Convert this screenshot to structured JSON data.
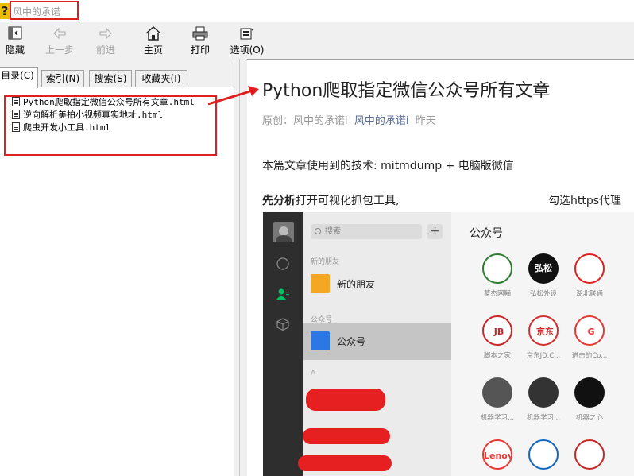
{
  "window": {
    "title": "风中的承诺"
  },
  "toolbar": {
    "hide": "隐藏",
    "back": "上一步",
    "forward": "前进",
    "home": "主页",
    "print": "打印",
    "options": "选项(O)"
  },
  "tabs": [
    {
      "label": "目录(C)"
    },
    {
      "label": "索引(N)"
    },
    {
      "label": "搜索(S)"
    },
    {
      "label": "收藏夹(I)"
    }
  ],
  "tree": [
    {
      "label": "Python爬取指定微信公众号所有文章.html"
    },
    {
      "label": "逆向解析美拍小视频真实地址.html"
    },
    {
      "label": "爬虫开发小工具.html"
    }
  ],
  "article": {
    "title": "Python爬取指定微信公众号所有文章",
    "meta_prefix": "原创：风中的承诺i",
    "meta_author": "风中的承诺i",
    "meta_time": "昨天",
    "p1": "本篇文章使用到的技术: mitmdump + 电脑版微信",
    "p2_bold": "先分析",
    "p2_text": "打开可视化抓包工具,",
    "p2_right": "勾选https代理"
  },
  "wechat": {
    "search_placeholder": "搜索",
    "plus": "+",
    "section_new": "新的朋友",
    "item_new": "新的朋友",
    "section_official": "公众号",
    "item_official": "公众号",
    "section_a": "A",
    "main_title": "公众号",
    "accounts": [
      {
        "name": "蒙杰网鞴",
        "logo_text": "",
        "color": "#2e7d32"
      },
      {
        "name": "弘松外设",
        "logo_text": "弘松",
        "color": "#111111"
      },
      {
        "name": "湖北联通",
        "logo_text": "",
        "color": "#e02020"
      },
      {
        "name": "脚本之家",
        "logo_text": "JB",
        "color": "#c62828"
      },
      {
        "name": "京东JD.C...",
        "logo_text": "京东",
        "color": "#d32f2f"
      },
      {
        "name": "进击的Co...",
        "logo_text": "G",
        "color": "#e53935"
      },
      {
        "name": "机器学习...",
        "logo_text": "",
        "color": "#555555"
      },
      {
        "name": "机器学习...",
        "logo_text": "",
        "color": "#333333"
      },
      {
        "name": "机器之心",
        "logo_text": "",
        "color": "#111111"
      },
      {
        "name": "",
        "logo_text": "Lenovo",
        "color": "#e53935"
      },
      {
        "name": "",
        "logo_text": "",
        "color": "#1565c0"
      },
      {
        "name": "",
        "logo_text": "",
        "color": "#c62828"
      }
    ]
  }
}
